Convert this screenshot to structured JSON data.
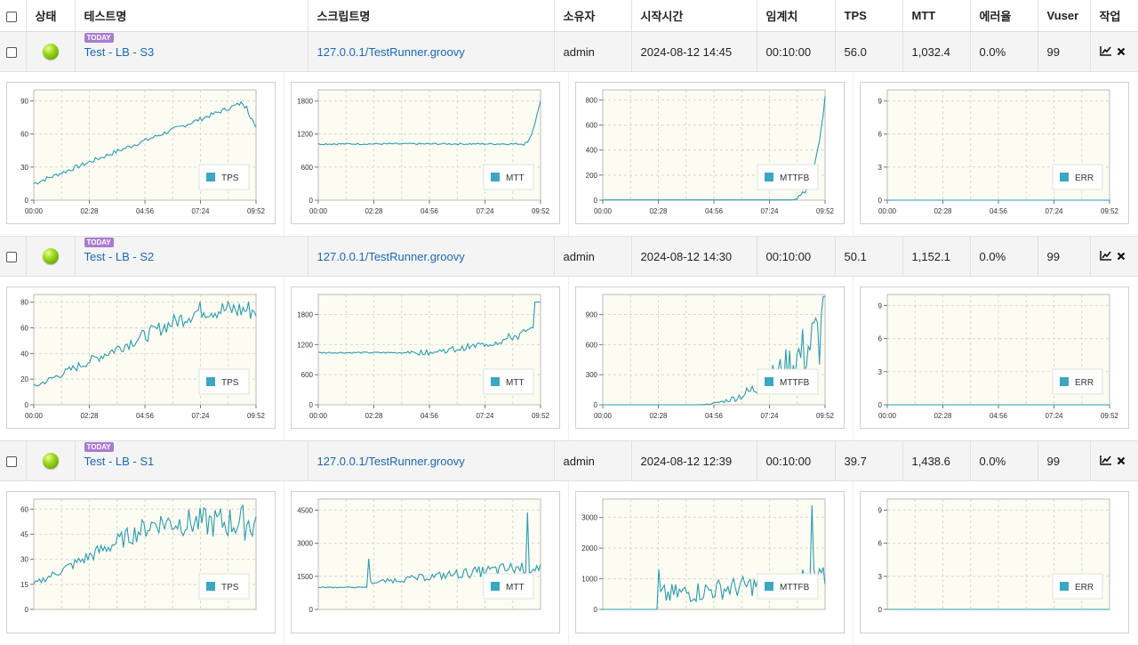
{
  "header": {
    "columns": [
      "상태",
      "테스트명",
      "스크립트명",
      "소유자",
      "시작시간",
      "임계치",
      "TPS",
      "MTT",
      "에러율",
      "Vuser",
      "작업"
    ]
  },
  "tests": [
    {
      "badge": "TODAY",
      "name": "Test - LB - S3",
      "script": "127.0.0.1/TestRunner.groovy",
      "owner": "admin",
      "start": "2024-08-12 14:45",
      "threshold": "00:10:00",
      "tps": "56.0",
      "mtt": "1,032.4",
      "error_rate": "0.0%",
      "vuser": "99",
      "charts": [
        {
          "legend": "TPS",
          "ymax": 100,
          "yticks": [
            "0",
            "30",
            "60",
            "90"
          ],
          "yvals": [
            0,
            30,
            60,
            90
          ],
          "xticks": [
            "00:00",
            "02:28",
            "04:56",
            "07:24",
            "09:52"
          ],
          "profile": "tps_s3"
        },
        {
          "legend": "MTT",
          "ymax": 2000,
          "yticks": [
            "0",
            "600",
            "1200",
            "1800"
          ],
          "yvals": [
            0,
            600,
            1200,
            1800
          ],
          "xticks": [
            "00:00",
            "02:28",
            "04:56",
            "07:24",
            "09:52"
          ],
          "profile": "mtt_s3"
        },
        {
          "legend": "MTTFB",
          "ymax": 880,
          "yticks": [
            "0",
            "200",
            "400",
            "600",
            "800"
          ],
          "yvals": [
            0,
            200,
            400,
            600,
            800
          ],
          "xticks": [
            "00:00",
            "02:28",
            "04:56",
            "07:24",
            "09:52"
          ],
          "profile": "mttfb_s3"
        },
        {
          "legend": "ERR",
          "ymax": 10,
          "yticks": [
            "0",
            "3",
            "6",
            "9"
          ],
          "yvals": [
            0,
            3,
            6,
            9
          ],
          "xticks": [
            "00:00",
            "02:28",
            "04:56",
            "07:24",
            "09:52"
          ],
          "profile": "err"
        }
      ]
    },
    {
      "badge": "TODAY",
      "name": "Test - LB - S2",
      "script": "127.0.0.1/TestRunner.groovy",
      "owner": "admin",
      "start": "2024-08-12 14:30",
      "threshold": "00:10:00",
      "tps": "50.1",
      "mtt": "1,152.1",
      "error_rate": "0.0%",
      "vuser": "99",
      "charts": [
        {
          "legend": "TPS",
          "ymax": 86,
          "yticks": [
            "0",
            "20",
            "40",
            "60",
            "80"
          ],
          "yvals": [
            0,
            20,
            40,
            60,
            80
          ],
          "xticks": [
            "00:00",
            "02:28",
            "04:56",
            "07:24",
            "09:52"
          ],
          "profile": "tps_s2"
        },
        {
          "legend": "MTT",
          "ymax": 2200,
          "yticks": [
            "0",
            "600",
            "1200",
            "1800"
          ],
          "yvals": [
            0,
            600,
            1200,
            1800
          ],
          "xticks": [
            "00:00",
            "02:28",
            "04:56",
            "07:24",
            "09:52"
          ],
          "profile": "mtt_s2"
        },
        {
          "legend": "MTTFB",
          "ymax": 1100,
          "yticks": [
            "0",
            "300",
            "600",
            "900"
          ],
          "yvals": [
            0,
            300,
            600,
            900
          ],
          "xticks": [
            "00:00",
            "02:28",
            "04:56",
            "07:24",
            "09:52"
          ],
          "profile": "mttfb_s2"
        },
        {
          "legend": "ERR",
          "ymax": 10,
          "yticks": [
            "0",
            "3",
            "6",
            "9"
          ],
          "yvals": [
            0,
            3,
            6,
            9
          ],
          "xticks": [
            "00:00",
            "02:28",
            "04:56",
            "07:24",
            "09:52"
          ],
          "profile": "err"
        }
      ]
    },
    {
      "badge": "TODAY",
      "name": "Test - LB - S1",
      "script": "127.0.0.1/TestRunner.groovy",
      "owner": "admin",
      "start": "2024-08-12 12:39",
      "threshold": "00:10:00",
      "tps": "39.7",
      "mtt": "1,438.6",
      "error_rate": "0.0%",
      "vuser": "99",
      "charts": [
        {
          "legend": "TPS",
          "ymax": 66,
          "yticks": [
            "0",
            "15",
            "30",
            "45",
            "60"
          ],
          "yvals": [
            0,
            15,
            30,
            45,
            60
          ],
          "xticks": [],
          "profile": "tps_s1"
        },
        {
          "legend": "MTT",
          "ymax": 5000,
          "yticks": [
            "0",
            "1500",
            "3000",
            "4500"
          ],
          "yvals": [
            0,
            1500,
            3000,
            4500
          ],
          "xticks": [],
          "profile": "mtt_s1"
        },
        {
          "legend": "MTTFB",
          "ymax": 3600,
          "yticks": [
            "0",
            "1000",
            "2000",
            "3000"
          ],
          "yvals": [
            0,
            1000,
            2000,
            3000
          ],
          "xticks": [],
          "profile": "mttfb_s1"
        },
        {
          "legend": "ERR",
          "ymax": 10,
          "yticks": [
            "0",
            "3",
            "6",
            "9"
          ],
          "yvals": [
            0,
            3,
            6,
            9
          ],
          "xticks": [],
          "profile": "err"
        }
      ]
    }
  ],
  "colors": {
    "line": "#2a9cb0",
    "legend": "#3aa7c3",
    "plot_bg": "#fcfcf2",
    "grid": "#d8d8d8",
    "link": "#1a68b8",
    "badge": "#a97bd1"
  },
  "icons": {
    "chart": "chart-line-icon",
    "delete": "close-icon"
  }
}
